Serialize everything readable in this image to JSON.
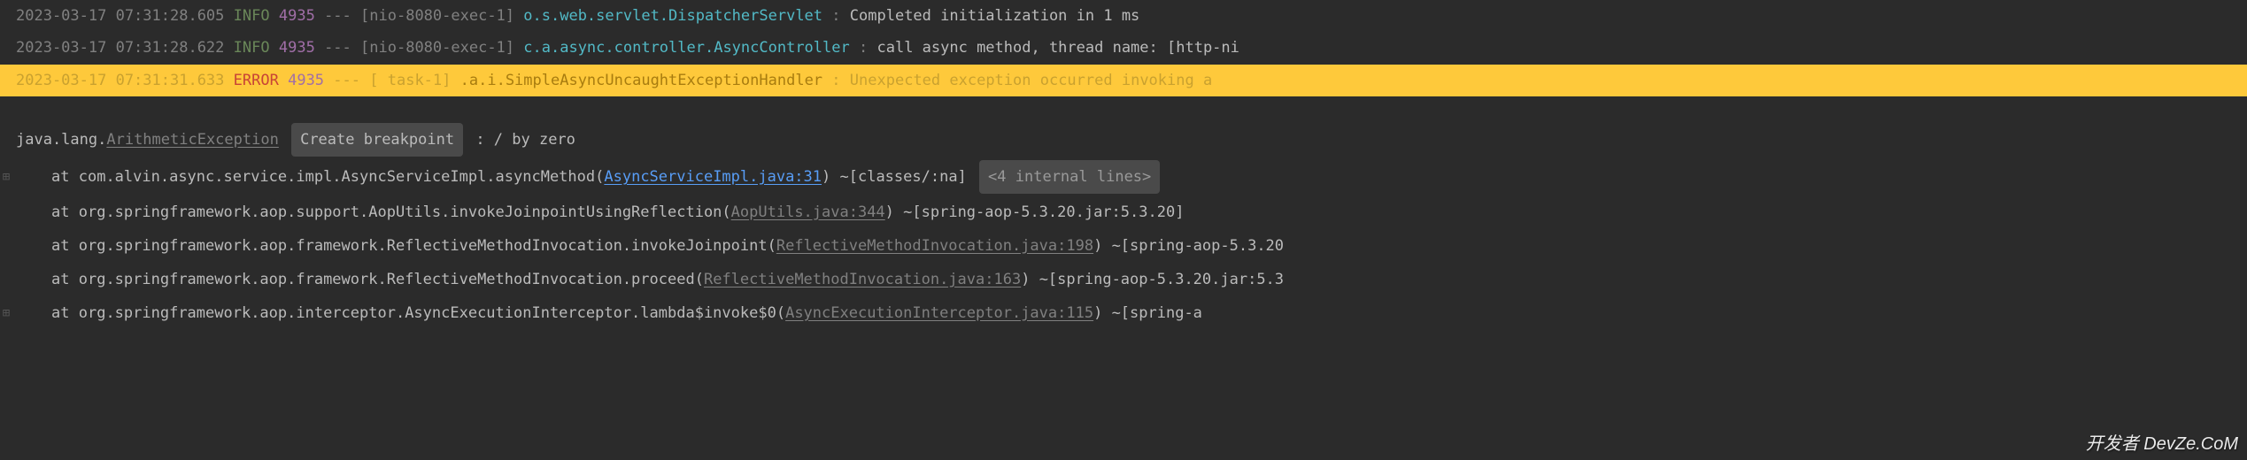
{
  "logs": [
    {
      "timestamp": "2023-03-17 07:31:28.605",
      "level": "INFO",
      "pid": "4935",
      "dashes": "---",
      "thread": "[nio-8080-exec-1]",
      "logger": "o.s.web.servlet.DispatcherServlet       ",
      "colon": ":",
      "message": "Completed initialization in 1 ms"
    },
    {
      "timestamp": "2023-03-17 07:31:28.622",
      "level": "INFO",
      "pid": "4935",
      "dashes": "---",
      "thread": "[nio-8080-exec-1]",
      "logger": "c.a.async.controller.AsyncController    ",
      "colon": ":",
      "message": "call async method, thread name: [http-ni"
    }
  ],
  "highlighted": {
    "timestamp": "2023-03-17 07:31:31.633",
    "level": "ERROR",
    "pid": "4935",
    "dashes": "---",
    "thread": "[         task-1]",
    "logger": ".a.i.SimpleAsyncUncaughtExceptionHandler",
    "colon": ":",
    "message": "Unexpected exception occurred invoking a"
  },
  "exception": {
    "prefix": "java.lang.",
    "class": "ArithmeticException",
    "breakpoint_label": "Create breakpoint",
    "suffix": " : / by zero"
  },
  "stack": [
    {
      "at": "at",
      "method": "com.alvin.async.service.impl.AsyncServiceImpl.asyncMethod",
      "file": "AsyncServiceImpl.java:31",
      "link_primary": true,
      "suffix": " ~[classes/:na]",
      "internal": "<4 internal lines>",
      "gutter": true
    },
    {
      "at": "at",
      "method": "org.springframework.aop.support.AopUtils.invokeJoinpointUsingReflection",
      "file": "AopUtils.java:344",
      "link_primary": false,
      "suffix": " ~[spring-aop-5.3.20.jar:5.3.20]",
      "gutter": false
    },
    {
      "at": "at",
      "method": "org.springframework.aop.framework.ReflectiveMethodInvocation.invokeJoinpoint",
      "file": "ReflectiveMethodInvocation.java:198",
      "link_primary": false,
      "suffix": " ~[spring-aop-5.3.20",
      "gutter": false
    },
    {
      "at": "at",
      "method": "org.springframework.aop.framework.ReflectiveMethodInvocation.proceed",
      "file": "ReflectiveMethodInvocation.java:163",
      "link_primary": false,
      "suffix": " ~[spring-aop-5.3.20.jar:5.3",
      "gutter": false
    },
    {
      "at": "at",
      "method": "org.springframework.aop.interceptor.AsyncExecutionInterceptor.lambda$invoke$0",
      "file": "AsyncExecutionInterceptor.java:115",
      "link_primary": false,
      "suffix": " ~[spring-a",
      "gutter": true
    }
  ],
  "watermark": "开发者 DevZe.CoM"
}
